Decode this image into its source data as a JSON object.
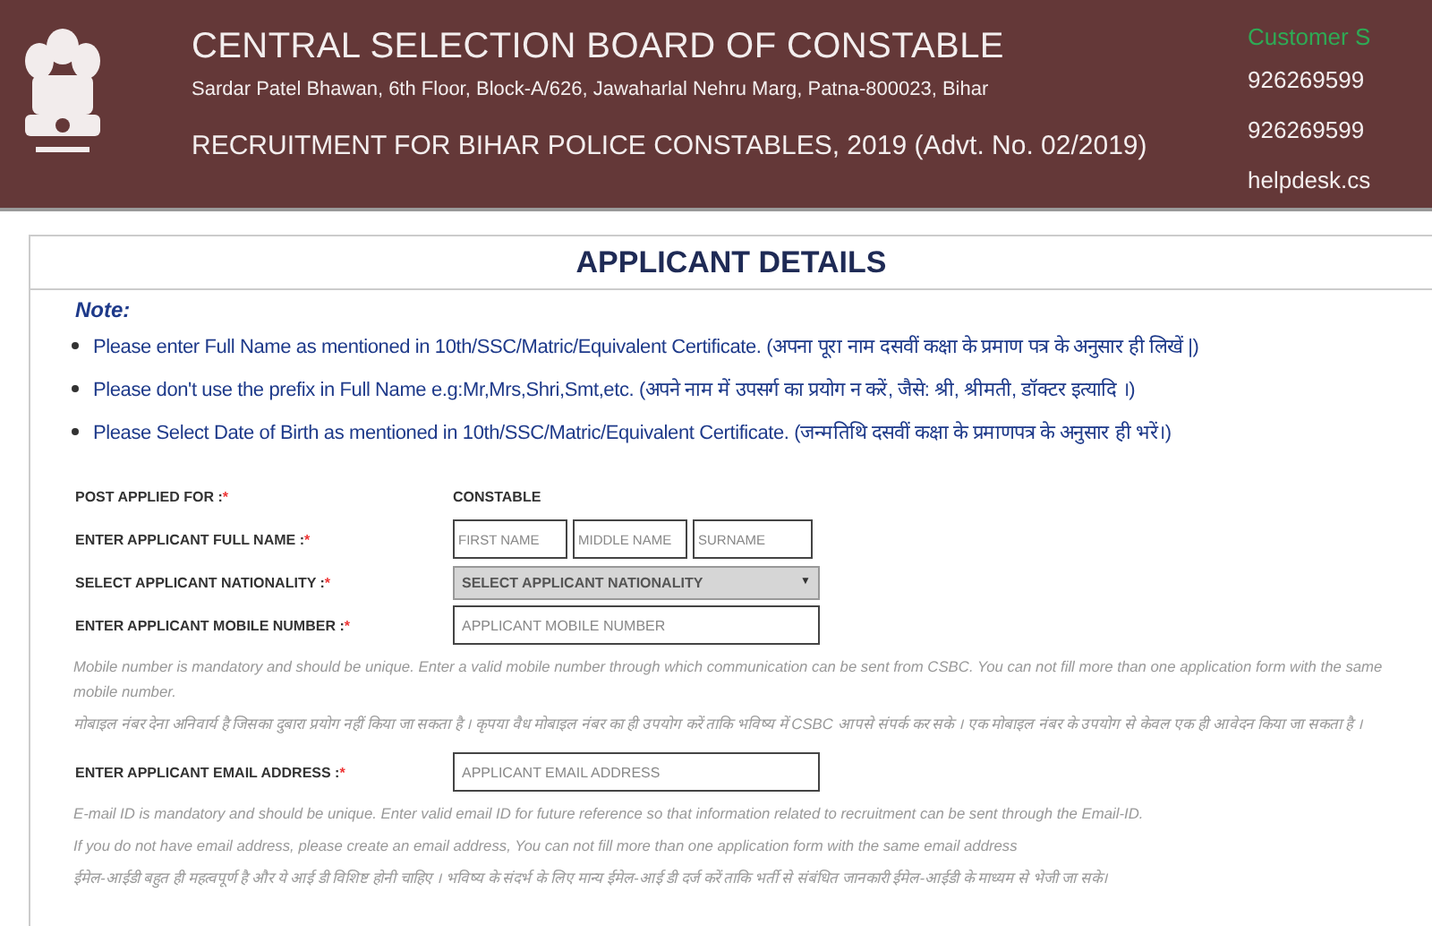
{
  "header": {
    "title": "CENTRAL SELECTION BOARD OF CONSTABLE",
    "address": "Sardar Patel Bhawan, 6th Floor, Block-A/626, Jawaharlal Nehru Marg, Patna-800023, Bihar",
    "recruitment": "RECRUITMENT FOR BIHAR POLICE CONSTABLES, 2019 (Advt. No. 02/2019)",
    "contact_heading": "Customer S",
    "contact_lines": [
      "926269599",
      "926269599",
      "helpdesk.cs"
    ]
  },
  "panel": {
    "title": "APPLICANT DETAILS",
    "note_heading": "Note:",
    "notes": [
      "Please enter Full Name as mentioned in 10th/SSC/Matric/Equivalent Certificate. (अपना पूरा नाम दसवीं कक्षा के प्रमाण पत्र के अनुसार ही लिखें |)",
      "Please don't use the prefix in Full Name e.g:Mr,Mrs,Shri,Smt,etc. (अपने नाम में उपसर्ग का प्रयोग न करें, जैसे: श्री, श्रीमती, डॉक्टर इत्यादि ।)",
      "Please Select Date of Birth as mentioned in 10th/SSC/Matric/Equivalent Certificate. (जन्मतिथि दसवीं कक्षा के प्रमाणपत्र के अनुसार ही भरें।)"
    ]
  },
  "fields": [
    {
      "kind": "static",
      "label": "POST APPLIED FOR :",
      "required": "*",
      "value": "CONSTABLE"
    },
    {
      "kind": "name",
      "label": "ENTER APPLICANT FULL NAME :",
      "required": "*",
      "placeholders": [
        "FIRST NAME",
        "MIDDLE NAME",
        "SURNAME"
      ]
    },
    {
      "kind": "select",
      "label": "SELECT APPLICANT NATIONALITY :",
      "required": "*",
      "value": "SELECT APPLICANT NATIONALITY",
      "caret": "▼"
    },
    {
      "kind": "input",
      "label": "ENTER APPLICANT MOBILE NUMBER :",
      "required": "*",
      "placeholder": "APPLICANT MOBILE NUMBER",
      "help": [
        "Mobile number is mandatory and should be unique. Enter a valid mobile number through which communication can be sent from CSBC. You can not fill more than one application form with the same mobile number.",
        "मोबाइल नंबर देना अनिवार्य है जिसका दुबारा प्रयोग नहीं किया जा सकता है । कृपया वैध मोबाइल नंबर का ही उपयोग करें ताकि भविष्य में CSBC आपसे संपर्क कर सके । एक मोबाइल नंबर के उपयोग से केवल एक ही आवेदन किया जा सकता है ।"
      ]
    },
    {
      "kind": "input",
      "label": "ENTER APPLICANT EMAIL ADDRESS :",
      "required": "*",
      "placeholder": "APPLICANT EMAIL ADDRESS",
      "help": [
        "E-mail ID is mandatory and should be unique. Enter valid email ID for future reference so that information related to recruitment can be sent through the Email-ID.",
        "If you do not have email address, please create an email address, You can not fill more than one application form with the same email address",
        "ईमेल-आईडी बहुत ही महत्वपूर्ण है और ये आई डी विशिष्ट होनी चाहिए । भविष्य के संदर्भ के लिए मान्य ईमेल-आई डी दर्ज करें ताकि भर्ती से संबंधित जानकारी ईमेल-आईडी के माध्यम से भेजी जा सके।"
      ]
    }
  ]
}
